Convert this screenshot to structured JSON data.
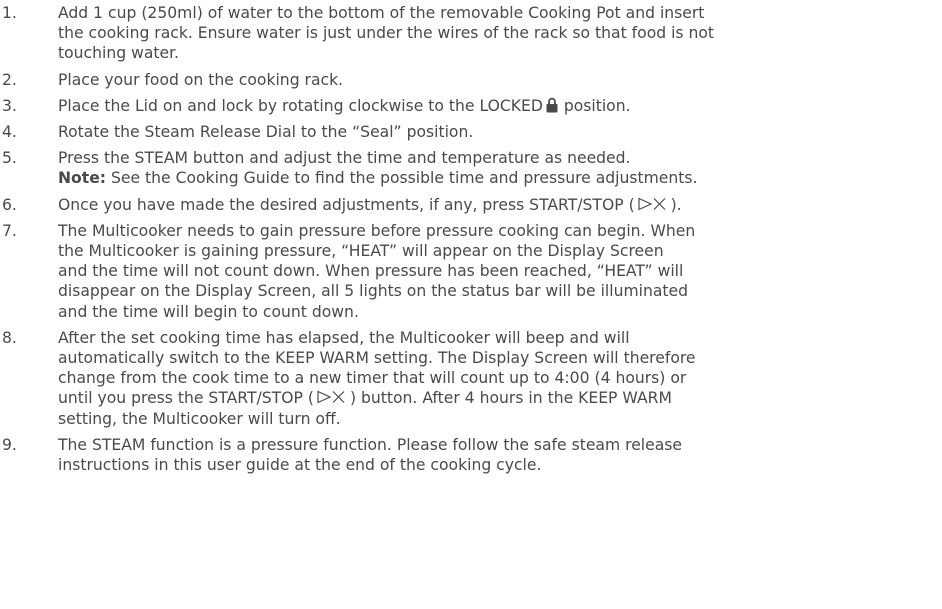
{
  "steps": [
    {
      "number": "1.",
      "lines": [
        "Add 1 cup (250ml) of water to the bottom of the removable Cooking Pot and insert",
        "the cooking rack. Ensure water is just under the wires of the rack so that food is not",
        "touching water."
      ]
    },
    {
      "number": "2.",
      "lines": [
        "Place your food on the cooking rack."
      ]
    },
    {
      "number": "3.",
      "text_before": "Place the Lid on and lock by rotating clockwise to the LOCKED",
      "icon": "lock-icon",
      "text_after": "position."
    },
    {
      "number": "4.",
      "lines": [
        "Rotate the Steam Release Dial to the “Seal” position."
      ]
    },
    {
      "number": "5.",
      "lines": [
        "Press the STEAM button and adjust the time and temperature as needed."
      ],
      "note_label": "Note:",
      "note_text": " See the Cooking Guide to find the possible time and pressure adjustments."
    },
    {
      "number": "6.",
      "text_before": "Once you have made the desired adjustments, if any, press START/STOP (",
      "icon": "start-stop-icon",
      "text_after": ")."
    },
    {
      "number": "7.",
      "lines": [
        "The Multicooker needs to gain pressure before pressure cooking can begin. When",
        "the Multicooker is gaining pressure, “HEAT” will appear on the Display Screen",
        "and the time will not count down. When pressure has been reached, “HEAT” will",
        "disappear on the Display Screen, all 5 lights on the status bar will be illuminated",
        "and the time will begin to count down."
      ]
    },
    {
      "number": "8.",
      "lines_before": [
        "After the set cooking time has elapsed, the Multicooker will beep and will",
        "automatically switch to the KEEP WARM setting. The Display Screen will therefore",
        "change from the cook time to a new timer that will count up to 4:00 (4 hours) or"
      ],
      "inline_before": "until you press the START/STOP (",
      "icon": "start-stop-icon",
      "inline_after": ") button. After 4 hours in the KEEP WARM",
      "lines_after": [
        "setting, the Multicooker will turn off."
      ]
    },
    {
      "number": "9.",
      "lines": [
        "The STEAM function is a pressure function. Please follow the safe steam release",
        "instructions in this user guide at the end of the cooking cycle."
      ]
    }
  ]
}
